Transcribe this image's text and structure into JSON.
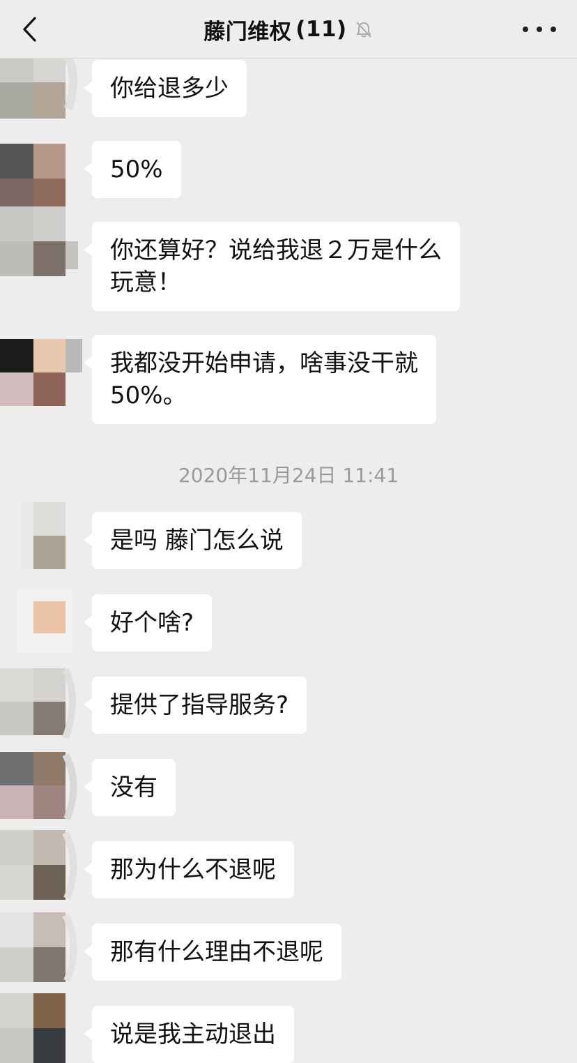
{
  "header": {
    "title": "藤门维权",
    "count": "(11)",
    "icons": {
      "back": "chevron-left-icon",
      "mute": "bell-muted-icon",
      "more": "more-dots-icon"
    }
  },
  "messages": [
    {
      "text": "你给退多少"
    },
    {
      "text": "50%"
    },
    {
      "text": "你还算好？说给我退２万是什么\n玩意！"
    },
    {
      "text": "我都没开始申请，啥事没干就\n50%。"
    },
    {
      "timestamp": "2020年11月24日 11:41"
    },
    {
      "text": "是吗 藤门怎么说"
    },
    {
      "text": "好个啥?"
    },
    {
      "text": "提供了指导服务?"
    },
    {
      "text": "没有"
    },
    {
      "text": "那为什么不退呢"
    },
    {
      "text": "那有什么理由不退呢"
    },
    {
      "text": "说是我主动退出"
    }
  ],
  "colors": {
    "background": "#ededed",
    "bubble": "#ffffff",
    "timestamp": "#9a9a9a"
  }
}
